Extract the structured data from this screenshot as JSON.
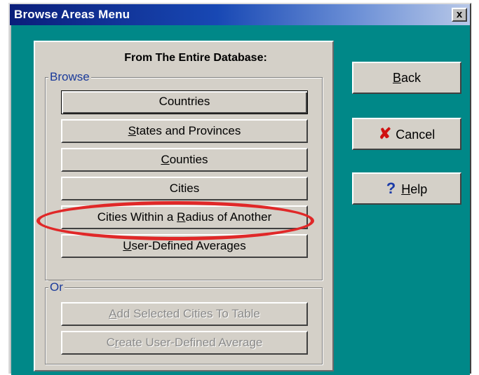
{
  "window": {
    "title": "Browse Areas Menu",
    "close_label": "x"
  },
  "panel": {
    "heading": "From The Entire Database:",
    "browse_group": {
      "label": "Browse",
      "buttons": [
        {
          "pre": "",
          "key": "",
          "post": "Countries"
        },
        {
          "pre": "",
          "key": "S",
          "post": "tates and Provinces"
        },
        {
          "pre": "",
          "key": "C",
          "post": "ounties"
        },
        {
          "pre": "",
          "key": "",
          "post": "Cities"
        },
        {
          "pre": "Cities Within a ",
          "key": "R",
          "post": "adius of Another"
        },
        {
          "pre": "",
          "key": "U",
          "post": "ser-Defined Averages"
        }
      ]
    },
    "or_group": {
      "label": "Or",
      "buttons": [
        {
          "pre": "",
          "key": "A",
          "post": "dd Selected Cities To Table"
        },
        {
          "pre": "C",
          "key": "r",
          "post": "eate User-Defined Average"
        }
      ]
    }
  },
  "side_buttons": {
    "back": {
      "key": "B",
      "post": "ack"
    },
    "cancel": {
      "icon": "cancel-x-icon",
      "label": "Cancel"
    },
    "help": {
      "icon": "help-question-icon",
      "key": "H",
      "post": "elp"
    }
  },
  "colors": {
    "background": "#008888",
    "face": "#d4d0c8",
    "highlight": "#e02828",
    "title_start": "#0a1e7a"
  }
}
